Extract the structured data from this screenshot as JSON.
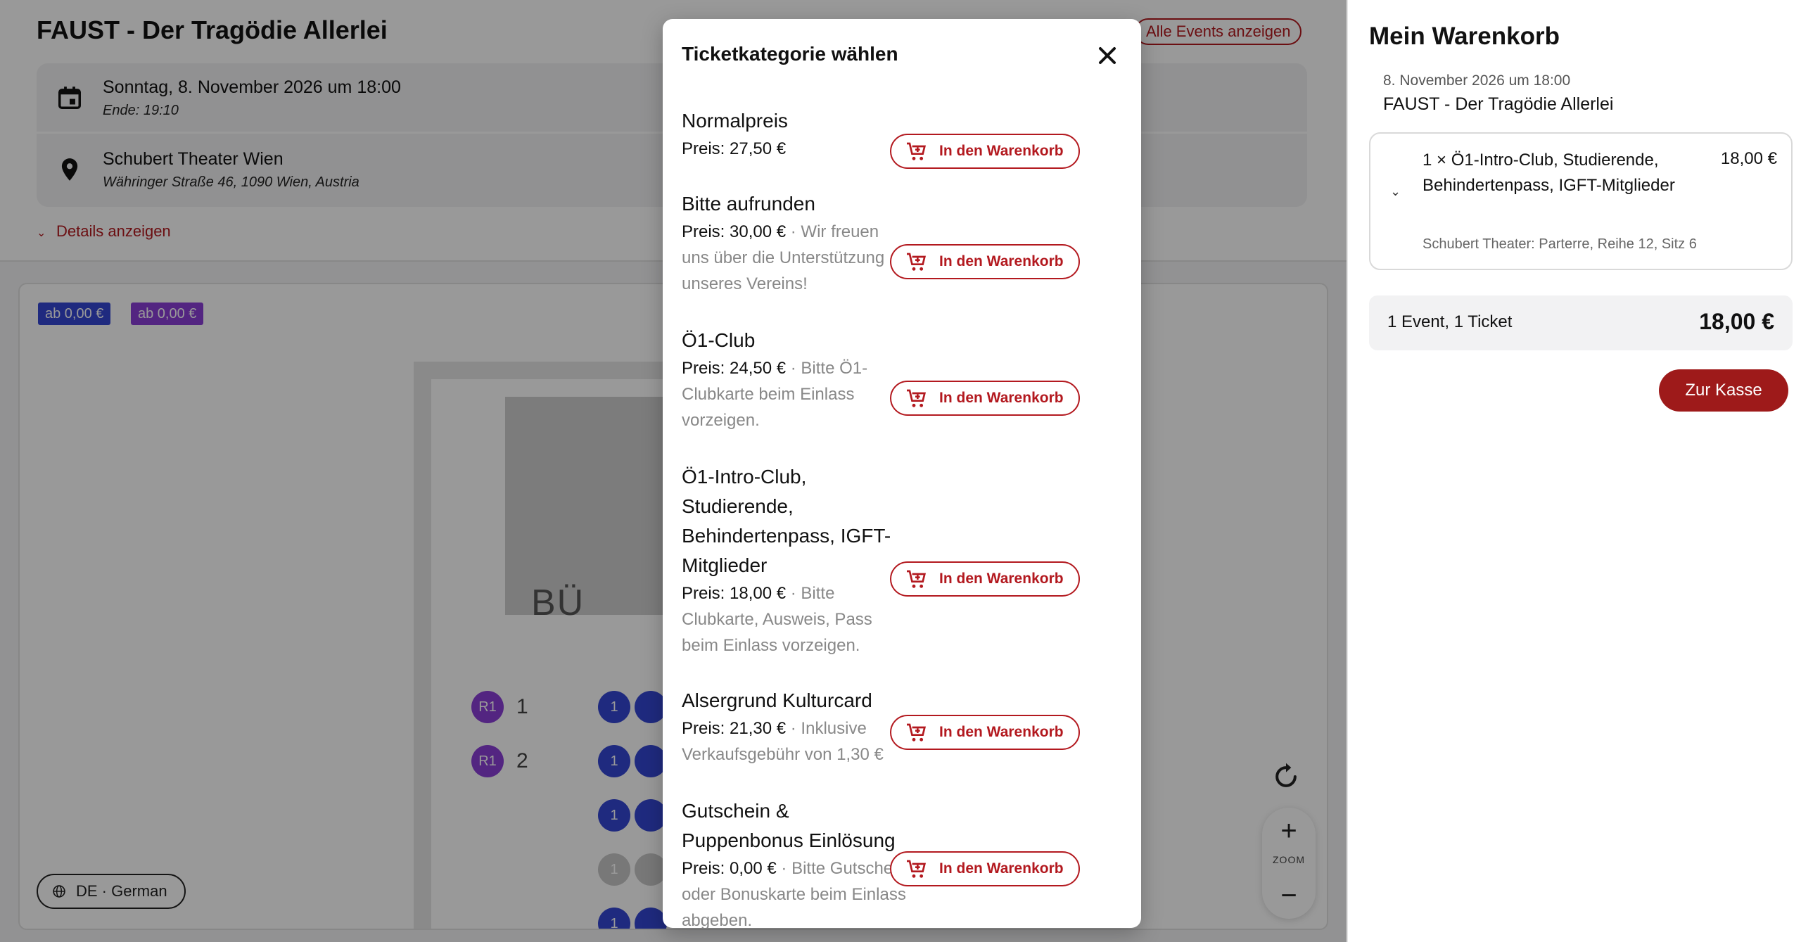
{
  "event": {
    "title": "FAUST - Der Tragödie Allerlei",
    "all_events_label": "Alle Events anzeigen",
    "date": "Sonntag, 8. November 2026 um 18:00",
    "end": "Ende: 19:10",
    "venue": "Schubert Theater Wien",
    "address": "Währinger Straße 46, 1090 Wien, Austria",
    "details_label": "Details anzeigen"
  },
  "seatmap": {
    "price_tags": [
      "ab 0,00 €",
      "ab 0,00 €"
    ],
    "stage_label": "BÜ",
    "row_badges": [
      "R1",
      "R1"
    ],
    "row_numbers": [
      "1",
      "2"
    ],
    "seat_label": "1",
    "zoom_label": "ZOOM",
    "zoom_in": "+",
    "zoom_out": "−"
  },
  "language": {
    "label": "DE · German"
  },
  "modal": {
    "title": "Ticketkategorie wählen",
    "add_label": "In den Warenkorb",
    "categories": [
      {
        "name": "Normalpreis",
        "price": "Preis: 27,50 €",
        "note": ""
      },
      {
        "name": "Bitte aufrunden",
        "price": "Preis: 30,00 €",
        "note": " · Wir freuen uns über die Unterstützung unseres Vereins!"
      },
      {
        "name": "Ö1-Club",
        "price": "Preis: 24,50 €",
        "note": " · Bitte Ö1-Clubkarte beim Einlass vorzeigen."
      },
      {
        "name": "Ö1-Intro-Club, Studierende, Behindertenpass, IGFT-Mitglieder",
        "price": "Preis: 18,00 €",
        "note": " · Bitte Clubkarte, Ausweis, Pass beim Einlass vorzeigen."
      },
      {
        "name": "Alsergrund Kulturcard",
        "price": "Preis: 21,30 €",
        "note": " · Inklusive Verkaufsgebühr von 1,30 €"
      },
      {
        "name": "Gutschein & Puppenbonus Einlösung",
        "price": "Preis: 0,00 €",
        "note": " · Bitte Gutschein oder Bonuskarte beim Einlass abgeben."
      }
    ]
  },
  "cart": {
    "title": "Mein Warenkorb",
    "date": "8. November 2026 um 18:00",
    "event": "FAUST - Der Tragödie Allerlei",
    "item_name": "1 × Ö1-Intro-Club, Studierende, Behindertenpass, IGFT-Mitglieder",
    "item_price": "18,00 €",
    "item_seat": "Schubert Theater: Parterre, Reihe 12, Sitz 6",
    "summary_label": "1 Event, 1 Ticket",
    "summary_total": "18,00 €",
    "checkout_label": "Zur Kasse"
  },
  "colors": {
    "brand_red": "#b3191f",
    "checkout_red": "#9e1a1a",
    "seat_blue": "#3446d4",
    "seat_purple": "#8a3fd8"
  }
}
